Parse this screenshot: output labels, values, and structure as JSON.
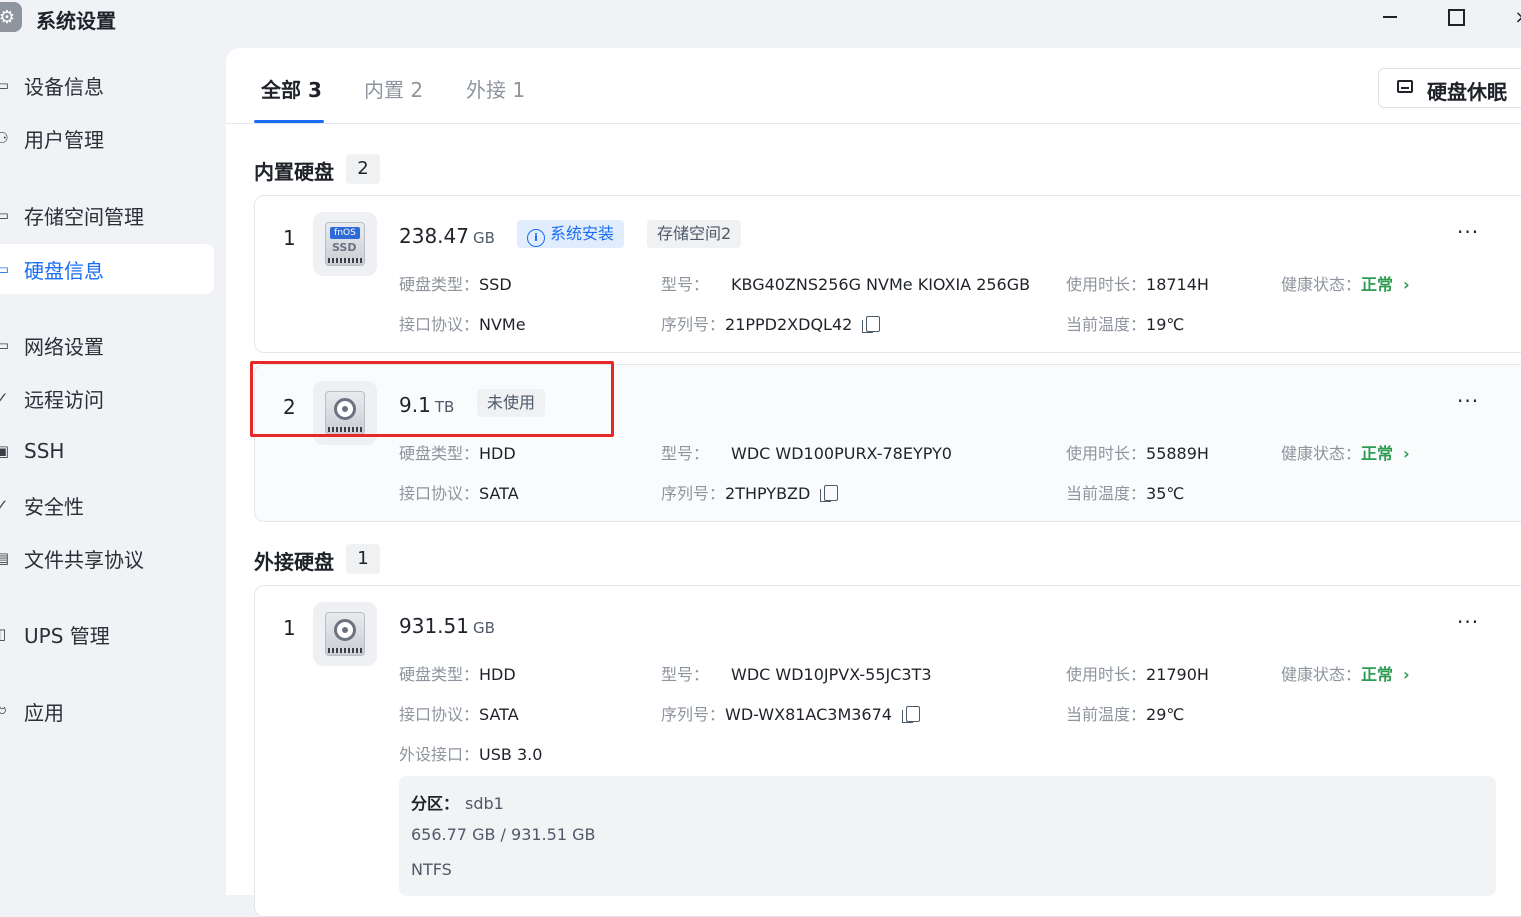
{
  "window": {
    "title": "系统设置",
    "app_icon": "gear-icon",
    "controls": {
      "minimize": "minimize-icon",
      "maximize": "maximize-icon",
      "close": "×"
    }
  },
  "sidebar": {
    "items": [
      {
        "label": "设备信息",
        "icon": "device-icon",
        "glyph": "▭"
      },
      {
        "label": "用户管理",
        "icon": "users-icon",
        "glyph": "⚇"
      },
      {
        "label": "存储空间管理",
        "icon": "storage-icon",
        "glyph": "▭"
      },
      {
        "label": "硬盘信息",
        "icon": "disk-icon",
        "glyph": "▭",
        "active": true
      },
      {
        "label": "网络设置",
        "icon": "network-icon",
        "glyph": "▭"
      },
      {
        "label": "远程访问",
        "icon": "remote-icon",
        "glyph": "✓"
      },
      {
        "label": "SSH",
        "icon": "terminal-icon",
        "glyph": "▣"
      },
      {
        "label": "安全性",
        "icon": "shield-icon",
        "glyph": "✓"
      },
      {
        "label": "文件共享协议",
        "icon": "share-icon",
        "glyph": "▤"
      },
      {
        "label": "UPS 管理",
        "icon": "ups-icon",
        "glyph": "▯"
      },
      {
        "label": "应用",
        "icon": "apps-icon",
        "glyph": "ဗ"
      }
    ]
  },
  "tabs": [
    {
      "label": "全部 3",
      "active": true
    },
    {
      "label": "内置 2"
    },
    {
      "label": "外接 1"
    }
  ],
  "toolbar": {
    "sleep_label": "硬盘休眠",
    "sleep_icon": "disk-sleep-icon"
  },
  "internal": {
    "title": "内置硬盘",
    "count": "2",
    "disks": [
      {
        "index": "1",
        "icon": "ssd-icon",
        "ssd_badge": "fnOS",
        "ssd_text": "SSD",
        "capacity": "238.47",
        "unit": "GB",
        "tags": [
          "系统安装",
          "存储空间2"
        ],
        "type_label": "硬盘类型：",
        "type": "SSD",
        "model_label": "型号：",
        "model": "KBG40ZNS256G NVMe KIOXIA 256GB",
        "hours_label": "使用时长：",
        "hours": "18714H",
        "health_label": "健康状态：",
        "health": "正常",
        "iface_label": "接口协议：",
        "iface": "NVMe",
        "serial_label": "序列号：",
        "serial": "21PPD2XDQL42",
        "temp_label": "当前温度：",
        "temp": "19℃"
      },
      {
        "index": "2",
        "icon": "hdd-icon",
        "capacity": "9.1",
        "unit": "TB",
        "tags": [
          "未使用"
        ],
        "type_label": "硬盘类型：",
        "type": "HDD",
        "model_label": "型号：",
        "model": "WDC WD100PURX-78EYPY0",
        "hours_label": "使用时长：",
        "hours": "55889H",
        "health_label": "健康状态：",
        "health": "正常",
        "iface_label": "接口协议：",
        "iface": "SATA",
        "serial_label": "序列号：",
        "serial": "2THPYBZD",
        "temp_label": "当前温度：",
        "temp": "35℃"
      }
    ]
  },
  "external": {
    "title": "外接硬盘",
    "count": "1",
    "disks": [
      {
        "index": "1",
        "icon": "hdd-icon",
        "capacity": "931.51",
        "unit": "GB",
        "type_label": "硬盘类型：",
        "type": "HDD",
        "model_label": "型号：",
        "model": "WDC WD10JPVX-55JC3T3",
        "hours_label": "使用时长：",
        "hours": "21790H",
        "health_label": "健康状态：",
        "health": "正常",
        "iface_label": "接口协议：",
        "iface": "SATA",
        "serial_label": "序列号：",
        "serial": "WD-WX81AC3M3674",
        "temp_label": "当前温度：",
        "temp": "29℃",
        "port_label": "外设接口：",
        "port": "USB 3.0",
        "partition": {
          "label": "分区：",
          "name": "sdb1",
          "usage": "656.77 GB / 931.51 GB",
          "fs": "NTFS"
        }
      }
    ]
  },
  "more_glyph": "···",
  "chevron_glyph": "›",
  "info_glyph": "i",
  "colors": {
    "accent": "#1a6ef5",
    "ok": "#2e9c52",
    "highlight": "#e82727"
  }
}
